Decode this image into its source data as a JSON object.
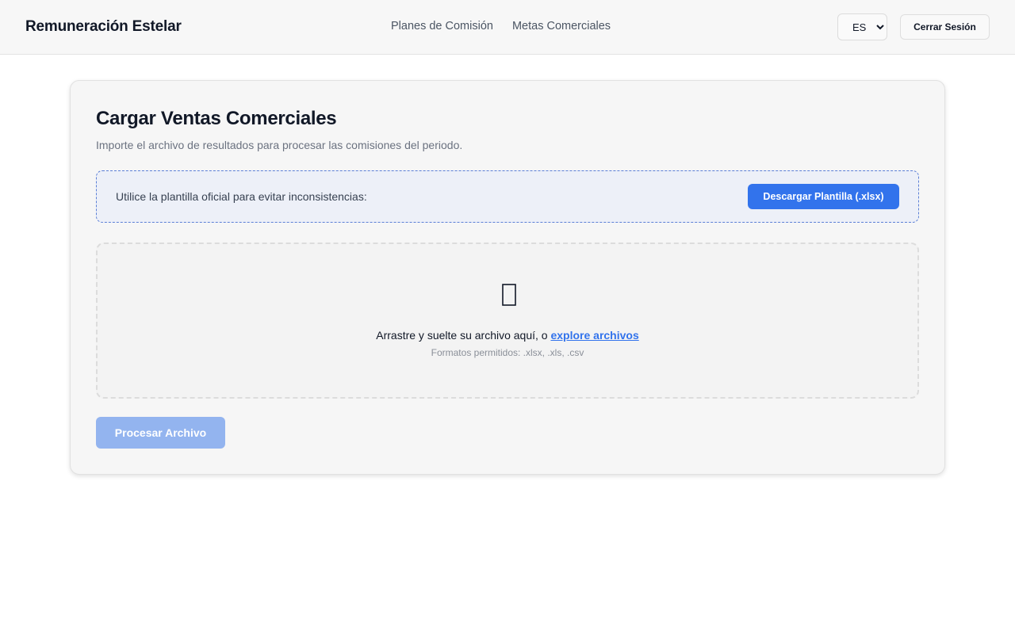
{
  "header": {
    "brand": "Remuneración Estelar",
    "nav": [
      {
        "label": "Planes de Comisión"
      },
      {
        "label": "Metas Comerciales"
      }
    ],
    "language": {
      "selected": "ES",
      "options": [
        "ES"
      ]
    },
    "logout_label": "Cerrar Sesión"
  },
  "upload_card": {
    "title": "Cargar Ventas Comerciales",
    "subtitle": "Importe el archivo de resultados para procesar las comisiones del periodo.",
    "template_notice": "Utilice la plantilla oficial para evitar inconsistencias:",
    "download_label": "Descargar Plantilla (.xlsx)",
    "dropzone": {
      "icon": "file-placeholder-icon",
      "text_before": "Arrastre y suelte su archivo aquí, o ",
      "browse_label": "explore archivos",
      "hint": "Formatos permitidos: .xlsx, .xls, .csv"
    },
    "process_label": "Procesar Archivo",
    "process_enabled": false
  },
  "colors": {
    "accent": "#3273ec",
    "accent_disabled": "#93b4ef",
    "notice_background": "#edf0f8"
  }
}
